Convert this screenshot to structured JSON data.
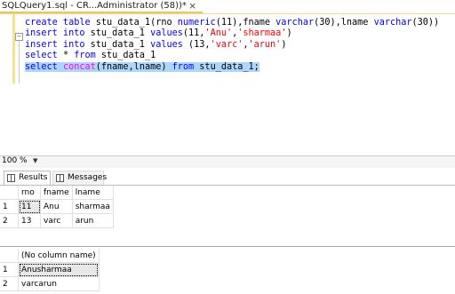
{
  "tab": {
    "title": "SQLQuery1.sql - CR...Administrator (58))*",
    "close_glyph": "×"
  },
  "editor": {
    "lines": [
      {
        "parts": [
          {
            "t": "create table ",
            "c": "kw"
          },
          {
            "t": "stu_data_1(rno ",
            "c": ""
          },
          {
            "t": "numeric",
            "c": "kw"
          },
          {
            "t": "(11),fname ",
            "c": ""
          },
          {
            "t": "varchar",
            "c": "kw"
          },
          {
            "t": "(30),lname ",
            "c": ""
          },
          {
            "t": "varchar",
            "c": "kw"
          },
          {
            "t": "(30))",
            "c": ""
          }
        ]
      },
      {
        "parts": [
          {
            "t": "insert into ",
            "c": "kw"
          },
          {
            "t": "stu_data_1 ",
            "c": ""
          },
          {
            "t": "values",
            "c": "kw"
          },
          {
            "t": "(11,",
            "c": ""
          },
          {
            "t": "'Anu'",
            "c": "str"
          },
          {
            "t": ",",
            "c": ""
          },
          {
            "t": "'sharmaa'",
            "c": "str"
          },
          {
            "t": ")",
            "c": ""
          }
        ]
      },
      {
        "parts": [
          {
            "t": "insert into ",
            "c": "kw"
          },
          {
            "t": "stu_data_1 ",
            "c": ""
          },
          {
            "t": "values ",
            "c": "kw"
          },
          {
            "t": "(13,",
            "c": ""
          },
          {
            "t": "'varc'",
            "c": "str"
          },
          {
            "t": ",",
            "c": ""
          },
          {
            "t": "'arun'",
            "c": "str"
          },
          {
            "t": ")",
            "c": ""
          }
        ]
      },
      {
        "parts": [
          {
            "t": "select ",
            "c": "kw"
          },
          {
            "t": "* ",
            "c": ""
          },
          {
            "t": "from ",
            "c": "kw"
          },
          {
            "t": "stu_data_1",
            "c": ""
          }
        ]
      },
      {
        "parts": [
          {
            "t": "select ",
            "c": "kw"
          },
          {
            "t": "concat",
            "c": "fn"
          },
          {
            "t": "(fname,lname) ",
            "c": ""
          },
          {
            "t": "from ",
            "c": "kw"
          },
          {
            "t": "stu_data_1;",
            "c": ""
          }
        ],
        "selected": true
      }
    ]
  },
  "zoom": {
    "value": "100 %",
    "arrow": "▼"
  },
  "results_tabs": [
    {
      "label": "Results"
    },
    {
      "label": "Messages"
    }
  ],
  "grid1": {
    "columns": [
      "rno",
      "fname",
      "lname"
    ],
    "rows": [
      {
        "num": "1",
        "cells": [
          "11",
          "Anu",
          "sharmaa"
        ]
      },
      {
        "num": "2",
        "cells": [
          "13",
          "varc",
          "arun"
        ]
      }
    ]
  },
  "grid2": {
    "columns": [
      "(No column name)"
    ],
    "rows": [
      {
        "num": "1",
        "cells": [
          "Anusharmaa"
        ]
      },
      {
        "num": "2",
        "cells": [
          "varcarun"
        ]
      }
    ]
  },
  "colors": {
    "keyword": "#0000ff",
    "string": "#ff0000",
    "function": "#ff00ff",
    "selection": "#add6ff",
    "change_bar": "#f7e389"
  }
}
